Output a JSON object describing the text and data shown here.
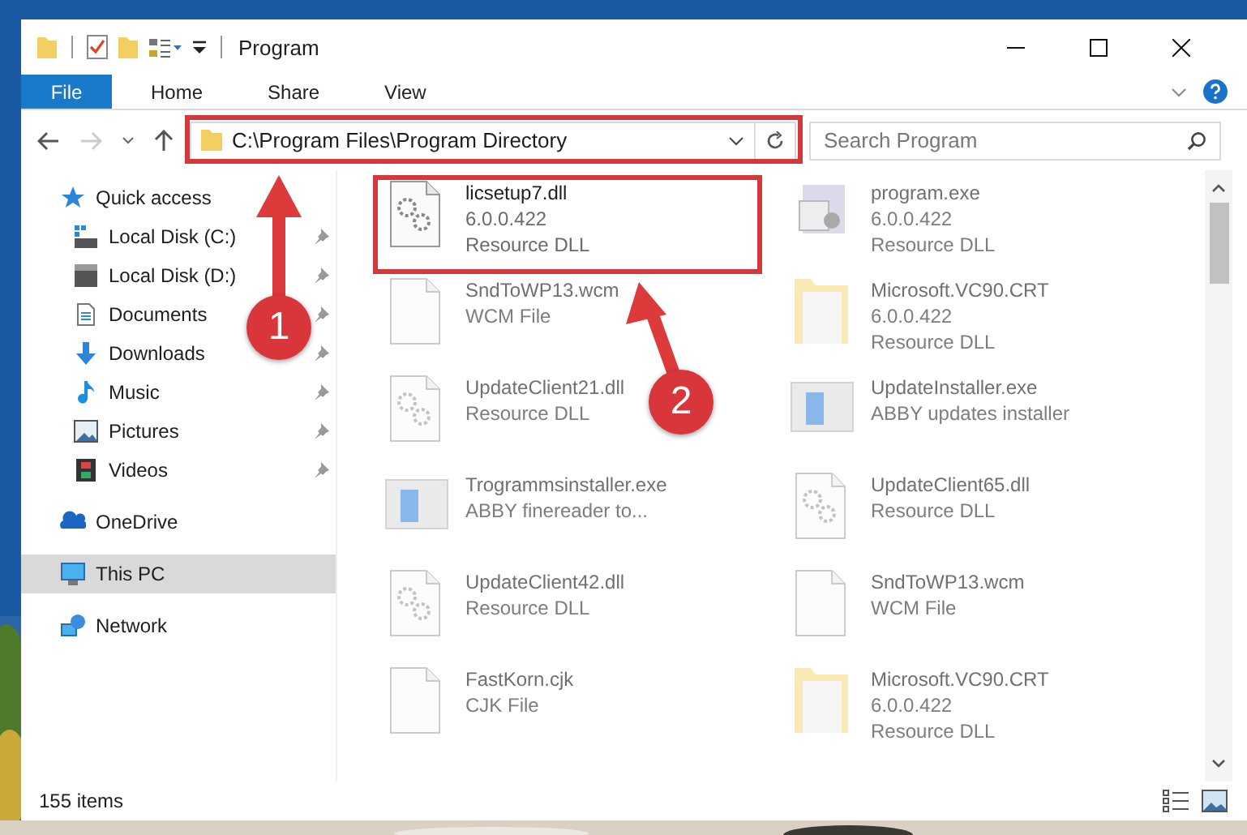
{
  "window": {
    "title": "Program"
  },
  "ribbon": {
    "tabs": [
      {
        "label": "File",
        "kind": "file",
        "selected": false
      },
      {
        "label": "Home",
        "kind": "tab",
        "selected": false
      },
      {
        "label": "Share",
        "kind": "tab",
        "selected": false
      },
      {
        "label": "View",
        "kind": "tab",
        "selected": false
      }
    ]
  },
  "address": {
    "path": "C:\\Program Files\\Program Directory"
  },
  "search": {
    "placeholder": "Search Program"
  },
  "sidebar": {
    "items": [
      {
        "label": "Quick access",
        "selected": false,
        "children": [
          {
            "label": "Local Disk (C:)",
            "pinned": true
          },
          {
            "label": "Local Disk (D:)",
            "pinned": true
          },
          {
            "label": "Documents",
            "pinned": true
          },
          {
            "label": "Downloads",
            "pinned": true
          },
          {
            "label": "Music",
            "pinned": true
          },
          {
            "label": "Pictures",
            "pinned": true
          },
          {
            "label": "Videos",
            "pinned": true
          }
        ]
      },
      {
        "label": "OneDrive",
        "selected": false
      },
      {
        "label": "This PC",
        "selected": true
      },
      {
        "label": "Network",
        "selected": false
      }
    ]
  },
  "files": [
    {
      "name": "licsetup7.dll",
      "details": [
        "6.0.0.422",
        "Resource DLL"
      ],
      "kind": "gear",
      "faded": false
    },
    {
      "name": "program.exe",
      "details": [
        "6.0.0.422",
        "Resource DLL"
      ],
      "kind": "exe",
      "faded": true
    },
    {
      "name": "SndToWP13.wcm",
      "details": [
        "WCM File"
      ],
      "kind": "blank",
      "faded": true
    },
    {
      "name": "Microsoft.VC90.CRT",
      "details": [
        "6.0.0.422",
        "Resource DLL"
      ],
      "kind": "folder",
      "faded": true
    },
    {
      "name": "UpdateClient21.dll",
      "details": [
        "Resource DLL"
      ],
      "kind": "gear",
      "faded": true
    },
    {
      "name": "UpdateInstaller.exe",
      "details": [
        "ABBY updates installer"
      ],
      "kind": "app",
      "faded": true
    },
    {
      "name": "Trogrammsinstaller.exe",
      "details": [
        "ABBY finereader to..."
      ],
      "kind": "app",
      "faded": true
    },
    {
      "name": "UpdateClient65.dll",
      "details": [
        "Resource DLL"
      ],
      "kind": "gear",
      "faded": true
    },
    {
      "name": "UpdateClient42.dll",
      "details": [
        "Resource DLL"
      ],
      "kind": "gear",
      "faded": true
    },
    {
      "name": "SndToWP13.wcm",
      "details": [
        "WCM File"
      ],
      "kind": "blank",
      "faded": true
    },
    {
      "name": "FastKorn.cjk",
      "details": [
        "CJK File"
      ],
      "kind": "blank",
      "faded": true
    },
    {
      "name": "Microsoft.VC90.CRT",
      "details": [
        "6.0.0.422",
        "Resource DLL"
      ],
      "kind": "folder",
      "faded": true
    }
  ],
  "status_bar": {
    "count": "155 items"
  },
  "callouts": [
    {
      "label": "1"
    },
    {
      "label": "2"
    }
  ]
}
